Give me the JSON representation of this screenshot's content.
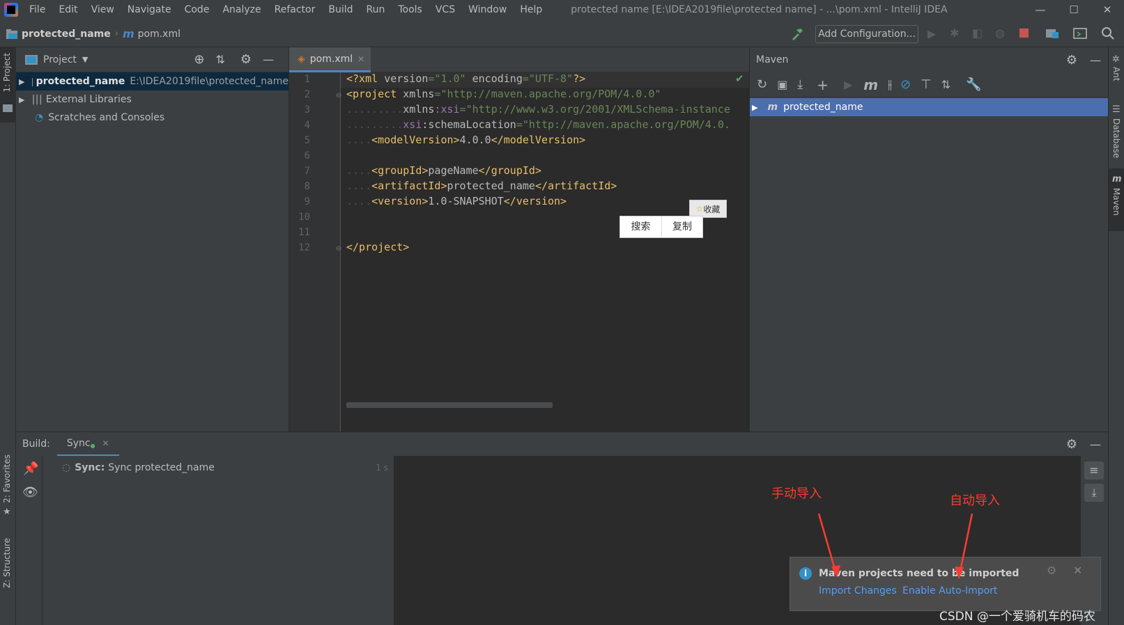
{
  "titlebar": {
    "menus": [
      "File",
      "Edit",
      "View",
      "Navigate",
      "Code",
      "Analyze",
      "Refactor",
      "Build",
      "Run",
      "Tools",
      "VCS",
      "Window",
      "Help"
    ],
    "title": "protected name [E:\\IDEA2019file\\protected name] - ...\\pom.xml - IntelliJ IDEA"
  },
  "navbar": {
    "crumb_project": "protected_name",
    "crumb_file": "pom.xml",
    "add_config": "Add Configuration..."
  },
  "left_strip": {
    "project": "1: Project",
    "favorites": "2: Favorites",
    "structure": "Z: Structure"
  },
  "right_strip": {
    "ant": "Ant",
    "database": "Database",
    "maven": "Maven"
  },
  "project_panel": {
    "title": "Project",
    "tree": {
      "root_name": "protected_name",
      "root_path": "E:\\IDEA2019file\\protected_name",
      "external": "External Libraries",
      "scratches": "Scratches and Consoles"
    }
  },
  "editor": {
    "tab": "pom.xml",
    "lines": [
      "1",
      "2",
      "3",
      "4",
      "5",
      "6",
      "7",
      "8",
      "9",
      "10",
      "11",
      "12"
    ],
    "code": {
      "l1_a": "<?xml ",
      "l1_b": "version",
      "l1_c": "=\"1.0\" ",
      "l1_d": "encoding",
      "l1_e": "=\"UTF-8\"",
      "l1_f": "?>",
      "l2_a": "<project ",
      "l2_b": "xmlns",
      "l2_c": "=\"http://maven.apache.org/POM/4.0.0\"",
      "l3_dots": ".........",
      "l3_a": "xmlns",
      "l3_b": ":xsi",
      "l3_c": "=\"http://www.w3.org/2001/XMLSchema-instance",
      "l4_dots": ".........",
      "l4_a": "xsi",
      "l4_b": ":schemaLocation",
      "l4_c": "=\"http://maven.apache.org/POM/4.0.",
      "l5_dots": "....",
      "l5_a": "<modelVersion>",
      "l5_b": "4.0.0",
      "l5_c": "</modelVersion>",
      "l7_dots": "....",
      "l7_a": "<groupId>",
      "l7_b": "pageName",
      "l7_c": "</groupId>",
      "l8_dots": "....",
      "l8_a": "<artifactId>",
      "l8_b": "protected_name",
      "l8_c": "</artifactId>",
      "l9_dots": "....",
      "l9_a": "<version>",
      "l9_b": "1.0-SNAPSHOT",
      "l9_c": "</version>",
      "l12": "</project>"
    },
    "popup": {
      "favorite": "收藏",
      "search": "搜索",
      "copy": "复制"
    }
  },
  "maven": {
    "title": "Maven",
    "root": "protected_name"
  },
  "build": {
    "label": "Build:",
    "tab": "Sync",
    "sync_bold": "Sync:",
    "sync_text": "Sync protected_name",
    "duration": "1 s"
  },
  "notification": {
    "message": "Maven projects need to be imported",
    "import_changes": "Import Changes",
    "enable_auto": "Enable Auto-Import"
  },
  "annotations": {
    "manual": "手动导入",
    "auto": "自动导入"
  },
  "watermark": "CSDN @一个爱骑机车的码农",
  "colors": {
    "selection": "#4b6eaf",
    "link": "#589df6",
    "annotation": "#ff3b30"
  }
}
